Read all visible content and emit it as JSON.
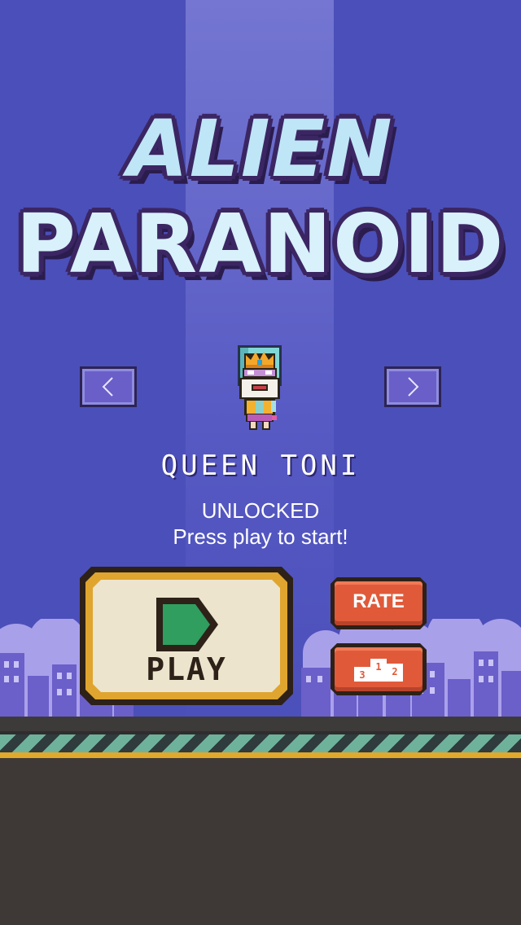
{
  "game": {
    "title_line1": "ALIEN",
    "title_line2": "PARANOID"
  },
  "character": {
    "name": "QUEEN TONI",
    "status": "UNLOCKED",
    "prompt": "Press play to start!"
  },
  "buttons": {
    "play_label": "PLAY",
    "rate_label": "RATE",
    "leaderboard_icon": "podium-icon",
    "prev_icon": "chevron-left-icon",
    "next_icon": "chevron-right-icon"
  },
  "colors": {
    "background": "#4b4fb9",
    "play_green": "#2f9e5f",
    "button_orange": "#e05a3a",
    "gold": "#e0a52e"
  }
}
